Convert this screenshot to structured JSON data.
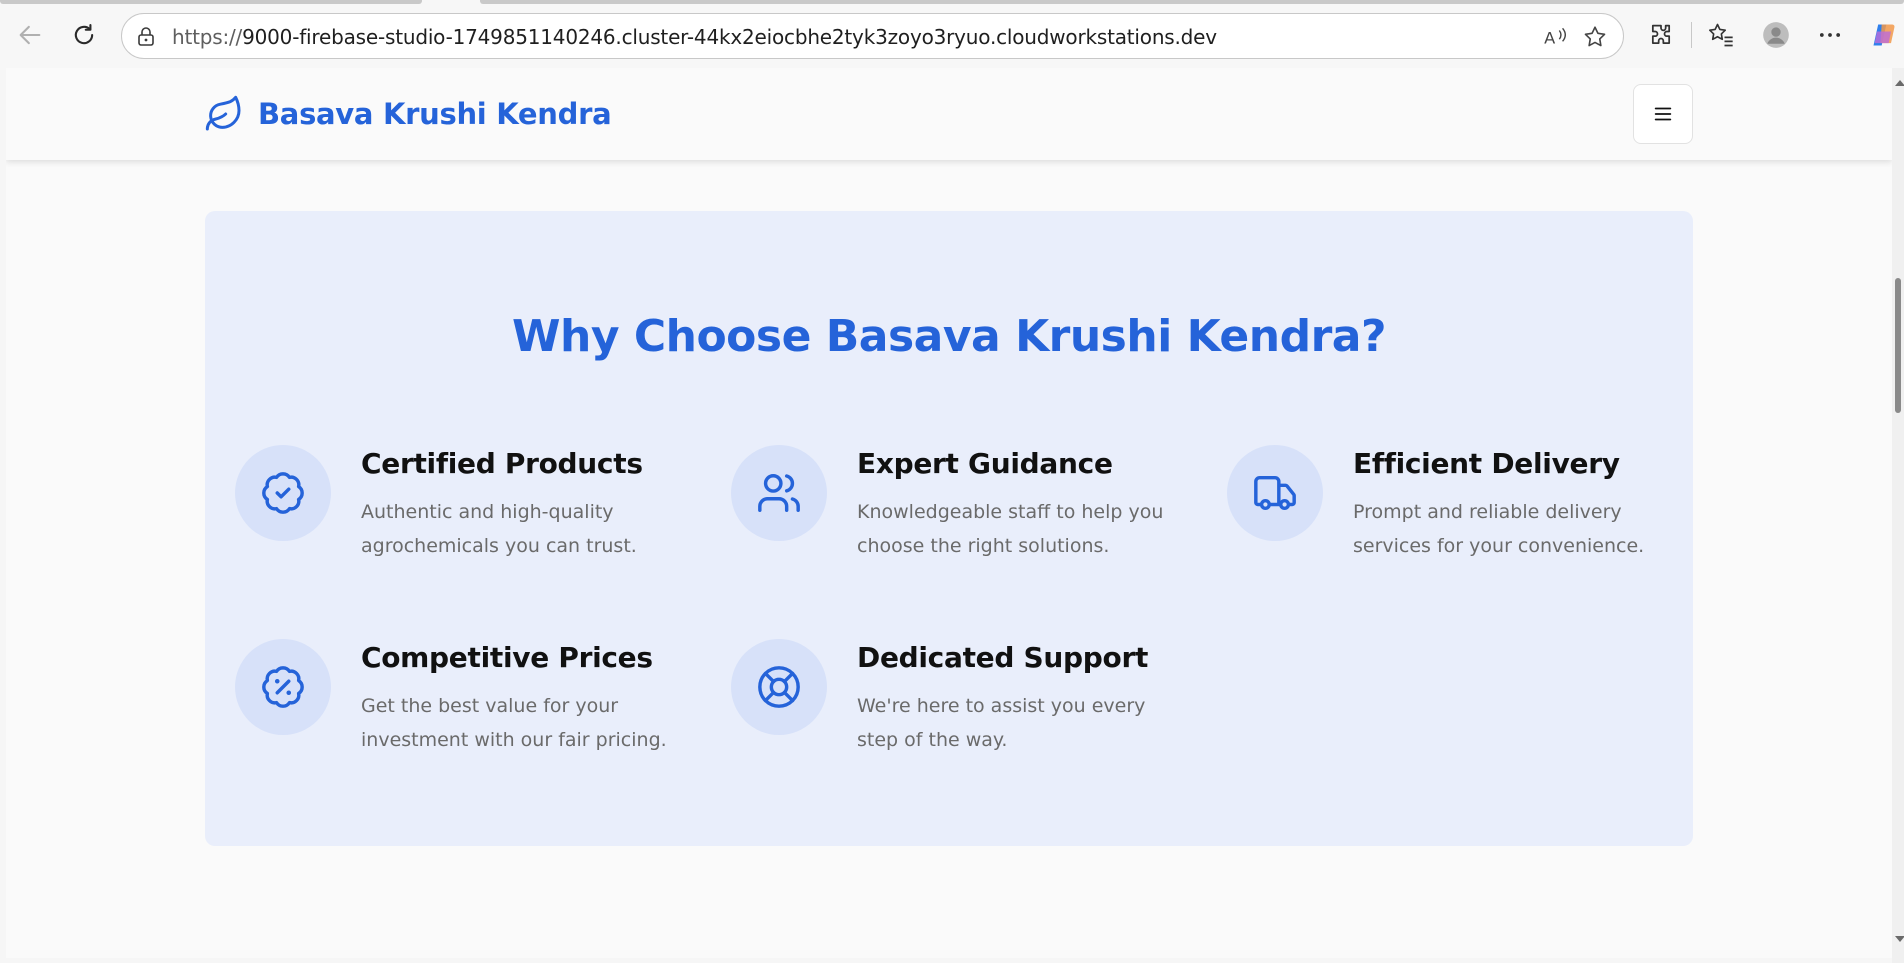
{
  "browser": {
    "url_scheme": "https://",
    "url_host": "9000-firebase-studio-1749851140246.cluster-44kx2eiocbhe2tyk3zoyo3ryuo.cloudworkstations.dev",
    "icons": [
      "back-icon",
      "refresh-icon",
      "lock-icon",
      "read-aloud-icon",
      "favorite-star-icon",
      "extensions-icon",
      "favorites-icon",
      "profile-icon",
      "more-icon",
      "copilot-icon"
    ]
  },
  "header": {
    "brand": "Basava Krushi Kendra",
    "brand_icon": "leaf-icon",
    "menu_icon": "hamburger-icon"
  },
  "features": {
    "heading": "Why Choose Basava Krushi Kendra?",
    "items": [
      {
        "title": "Certified Products",
        "desc": "Authentic and high-quality agrochemicals you can trust.",
        "icon": "badge-check-icon"
      },
      {
        "title": "Expert Guidance",
        "desc": "Knowledgeable staff to help you choose the right solutions.",
        "icon": "users-icon"
      },
      {
        "title": "Efficient Delivery",
        "desc": "Prompt and reliable delivery services for your convenience.",
        "icon": "truck-icon"
      },
      {
        "title": "Competitive Prices",
        "desc": "Get the best value for your investment with our fair pricing.",
        "icon": "badge-percent-icon"
      },
      {
        "title": "Dedicated Support",
        "desc": "We're here to assist you every step of the way.",
        "icon": "life-buoy-icon"
      }
    ]
  },
  "colors": {
    "brand_blue": "#2563d9",
    "section_bg": "#e9eefb",
    "icon_circle_bg": "#d7e1f9"
  }
}
